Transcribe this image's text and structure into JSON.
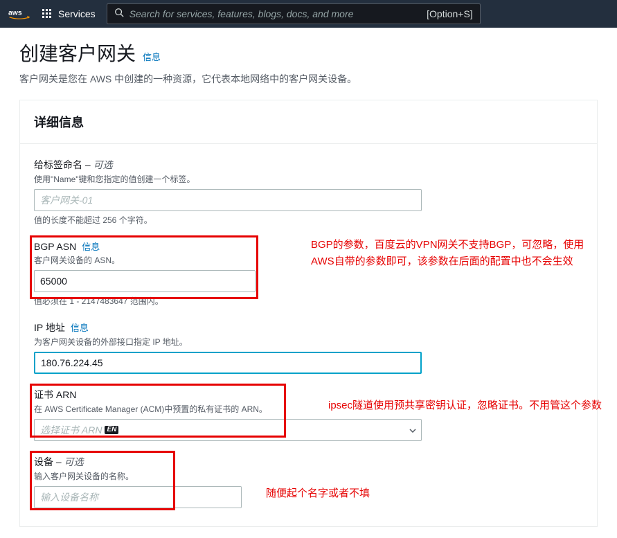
{
  "nav": {
    "services_label": "Services",
    "search_placeholder": "Search for services, features, blogs, docs, and more",
    "shortcut": "[Option+S]"
  },
  "page": {
    "title": "创建客户网关",
    "title_info": "信息",
    "description": "客户网关是您在 AWS 中创建的一种资源，它代表本地网络中的客户网关设备。"
  },
  "panel": {
    "title": "详细信息"
  },
  "fields": {
    "name": {
      "label": "给标签命名 –",
      "optional": "可选",
      "hint": "使用\"Name\"键和您指定的值创建一个标签。",
      "placeholder": "客户网关-01",
      "value": "",
      "note": "值的长度不能超过 256 个字符。"
    },
    "bgp": {
      "label": "BGP ASN",
      "info": "信息",
      "hint": "客户网关设备的 ASN。",
      "value": "65000",
      "note": "值必须在 1 - 2147483647 范围内。"
    },
    "ip": {
      "label": "IP 地址",
      "info": "信息",
      "hint": "为客户网关设备的外部接口指定 IP 地址。",
      "value": "180.76.224.45"
    },
    "cert": {
      "label": "证书 ARN",
      "hint": "在 AWS Certificate Manager (ACM)中预置的私有证书的 ARN。",
      "placeholder": "选择证书 ARN",
      "ime": "EN"
    },
    "device": {
      "label": "设备 –",
      "optional": "可选",
      "hint": "输入客户网关设备的名称。",
      "placeholder": "输入设备名称",
      "value": ""
    }
  },
  "annotations": {
    "bgp": "BGP的参数，百度云的VPN网关不支持BGP，可忽略，使用AWS自带的参数即可，该参数在后面的配置中也不会生效",
    "cert": "ipsec隧道使用预共享密钥认证，忽略证书。不用管这个参数",
    "device": "随便起个名字或者不填"
  }
}
